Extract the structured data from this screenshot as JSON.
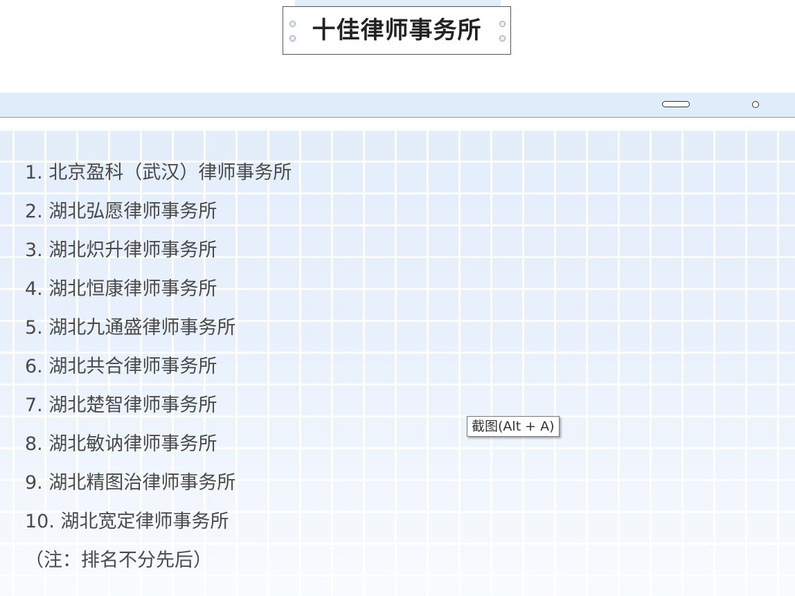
{
  "title": "十佳律师事务所",
  "items": [
    "1. 北京盈科（武汉）律师事务所",
    "2. 湖北弘愿律师事务所",
    "3. 湖北炽升律师事务所",
    "4. 湖北恒康律师事务所",
    "5. 湖北九通盛律师事务所",
    "6. 湖北共合律师事务所",
    "7. 湖北楚智律师事务所",
    "8. 湖北敏讷律师事务所",
    "9. 湖北精图治律师事务所",
    "10. 湖北宽定律师事务所"
  ],
  "note": "（注：排名不分先后）",
  "tooltip": "截图(Alt + A)"
}
